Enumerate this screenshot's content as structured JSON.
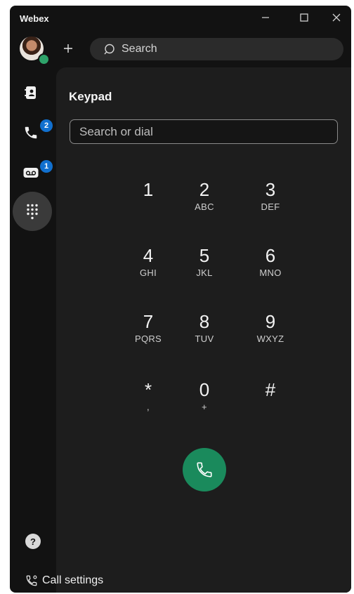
{
  "window": {
    "title": "Webex"
  },
  "top": {
    "search_placeholder": "Search"
  },
  "rail": {
    "items": [
      {
        "name": "contacts"
      },
      {
        "name": "calls",
        "badge": "2"
      },
      {
        "name": "voicemail",
        "badge": "1"
      },
      {
        "name": "keypad",
        "active": true
      }
    ]
  },
  "keypad": {
    "title": "Keypad",
    "input_placeholder": "Search or dial",
    "keys": [
      {
        "digit": "1",
        "letters": ""
      },
      {
        "digit": "2",
        "letters": "ABC"
      },
      {
        "digit": "3",
        "letters": "DEF"
      },
      {
        "digit": "4",
        "letters": "GHI"
      },
      {
        "digit": "5",
        "letters": "JKL"
      },
      {
        "digit": "6",
        "letters": "MNO"
      },
      {
        "digit": "7",
        "letters": "PQRS"
      },
      {
        "digit": "8",
        "letters": "TUV"
      },
      {
        "digit": "9",
        "letters": "WXYZ"
      },
      {
        "digit": "*",
        "letters": ","
      },
      {
        "digit": "0",
        "letters": "+"
      },
      {
        "digit": "#",
        "letters": ""
      }
    ]
  },
  "footer": {
    "call_settings": "Call settings"
  },
  "colors": {
    "call_green": "#1a8a5c",
    "badge_blue": "#1170cf",
    "presence_green": "#2ea36a"
  }
}
